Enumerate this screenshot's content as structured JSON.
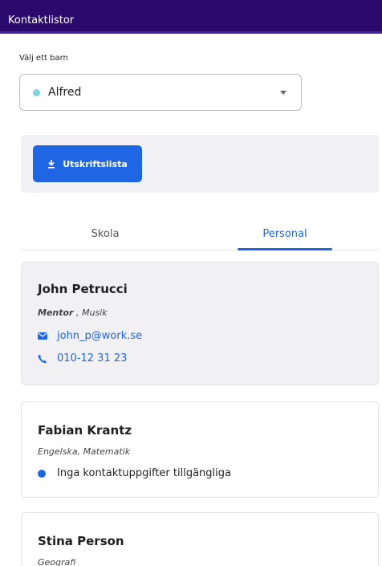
{
  "header": {
    "title": "Kontaktlistor"
  },
  "child_select": {
    "label": "Välj ett barn",
    "selected": "Alfred",
    "dot_color": "#7fd3e6"
  },
  "print": {
    "button_label": "Utskriftslista"
  },
  "tabs": [
    {
      "label": "Skola",
      "active": false
    },
    {
      "label": "Personal",
      "active": true
    }
  ],
  "contacts": [
    {
      "name": "John Petrucci",
      "role_primary": "Mentor",
      "role_rest": " , Musik",
      "email": "john_p@work.se",
      "phone": "010-12 31 23"
    },
    {
      "name": "Fabian Krantz",
      "subjects": "Engelska, Matematik",
      "no_contact_text": "Inga kontaktuppgifter tillgängliga"
    },
    {
      "name": "Stina Person",
      "subjects": "Geografi"
    }
  ],
  "colors": {
    "header_bg": "#2b0a6e",
    "accent": "#1f66e5",
    "panel_bg": "#f1f1f3"
  }
}
